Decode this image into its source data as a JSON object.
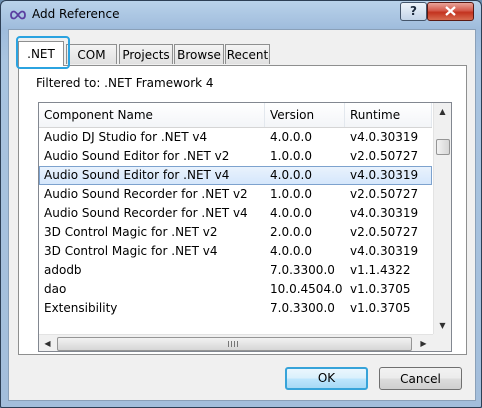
{
  "window": {
    "title": "Add Reference",
    "help_label": "?",
    "close_label": "x"
  },
  "tabs": [
    {
      "label": ".NET",
      "active": true
    },
    {
      "label": "COM"
    },
    {
      "label": "Projects"
    },
    {
      "label": "Browse"
    },
    {
      "label": "Recent"
    }
  ],
  "filter_text": "Filtered to: .NET Framework 4",
  "table": {
    "columns": [
      "Component Name",
      "Version",
      "Runtime"
    ],
    "rows": [
      {
        "name": "Audio DJ Studio for .NET v4",
        "version": "4.0.0.0",
        "runtime": "v4.0.30319"
      },
      {
        "name": "Audio Sound Editor for .NET v2",
        "version": "1.0.0.0",
        "runtime": "v2.0.50727"
      },
      {
        "name": "Audio Sound Editor for .NET v4",
        "version": "4.0.0.0",
        "runtime": "v4.0.30319",
        "selected": true
      },
      {
        "name": "Audio Sound Recorder for .NET v2",
        "version": "1.0.0.0",
        "runtime": "v2.0.50727"
      },
      {
        "name": "Audio Sound Recorder for .NET v4",
        "version": "4.0.0.0",
        "runtime": "v4.0.30319"
      },
      {
        "name": "3D Control Magic for .NET v2",
        "version": "2.0.0.0",
        "runtime": "v2.0.50727"
      },
      {
        "name": "3D Control Magic for .NET v4",
        "version": "4.0.0.0",
        "runtime": "v4.0.30319"
      },
      {
        "name": "adodb",
        "version": "7.0.3300.0",
        "runtime": "v1.1.4322"
      },
      {
        "name": "dao",
        "version": "10.0.4504.0",
        "runtime": "v1.0.3705"
      },
      {
        "name": "Extensibility",
        "version": "7.0.3300.0",
        "runtime": "v1.0.3705"
      }
    ]
  },
  "buttons": {
    "ok": "OK",
    "cancel": "Cancel"
  },
  "colors": {
    "selection_border": "#7da2ce",
    "focus_ring": "#2ba3e0",
    "close_button": "#c3331f"
  }
}
